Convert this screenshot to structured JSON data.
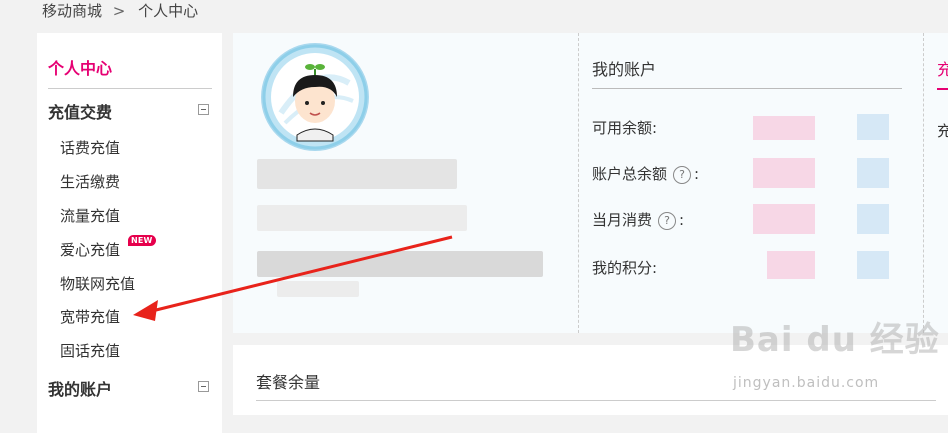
{
  "breadcrumb": {
    "root": "移动商城",
    "separator": ">",
    "current": "个人中心"
  },
  "sidebar": {
    "title": "个人中心",
    "sections": [
      {
        "label": "充值交费",
        "items": [
          {
            "label": "话费充值"
          },
          {
            "label": "生活缴费"
          },
          {
            "label": "流量充值"
          },
          {
            "label": "爱心充值",
            "badge": "NEW"
          },
          {
            "label": "物联网充值"
          },
          {
            "label": "宽带充值"
          },
          {
            "label": "固话充值"
          }
        ]
      },
      {
        "label": "我的账户"
      }
    ]
  },
  "account": {
    "title": "我的账户",
    "rows": [
      {
        "label": "可用余额:"
      },
      {
        "label": "账户总余额",
        "suffix": ":"
      },
      {
        "label": "当月消费",
        "suffix": ":"
      },
      {
        "label": "我的积分:"
      }
    ],
    "help_glyph": "?"
  },
  "right_panel": {
    "title": "充",
    "text": "充"
  },
  "lower": {
    "title": "套餐余量"
  },
  "watermark": {
    "brand": "Bai du 经验",
    "url": "jingyan.baidu.com"
  },
  "colors": {
    "accent": "#e60073",
    "annotation_arrow": "#e8231b"
  }
}
